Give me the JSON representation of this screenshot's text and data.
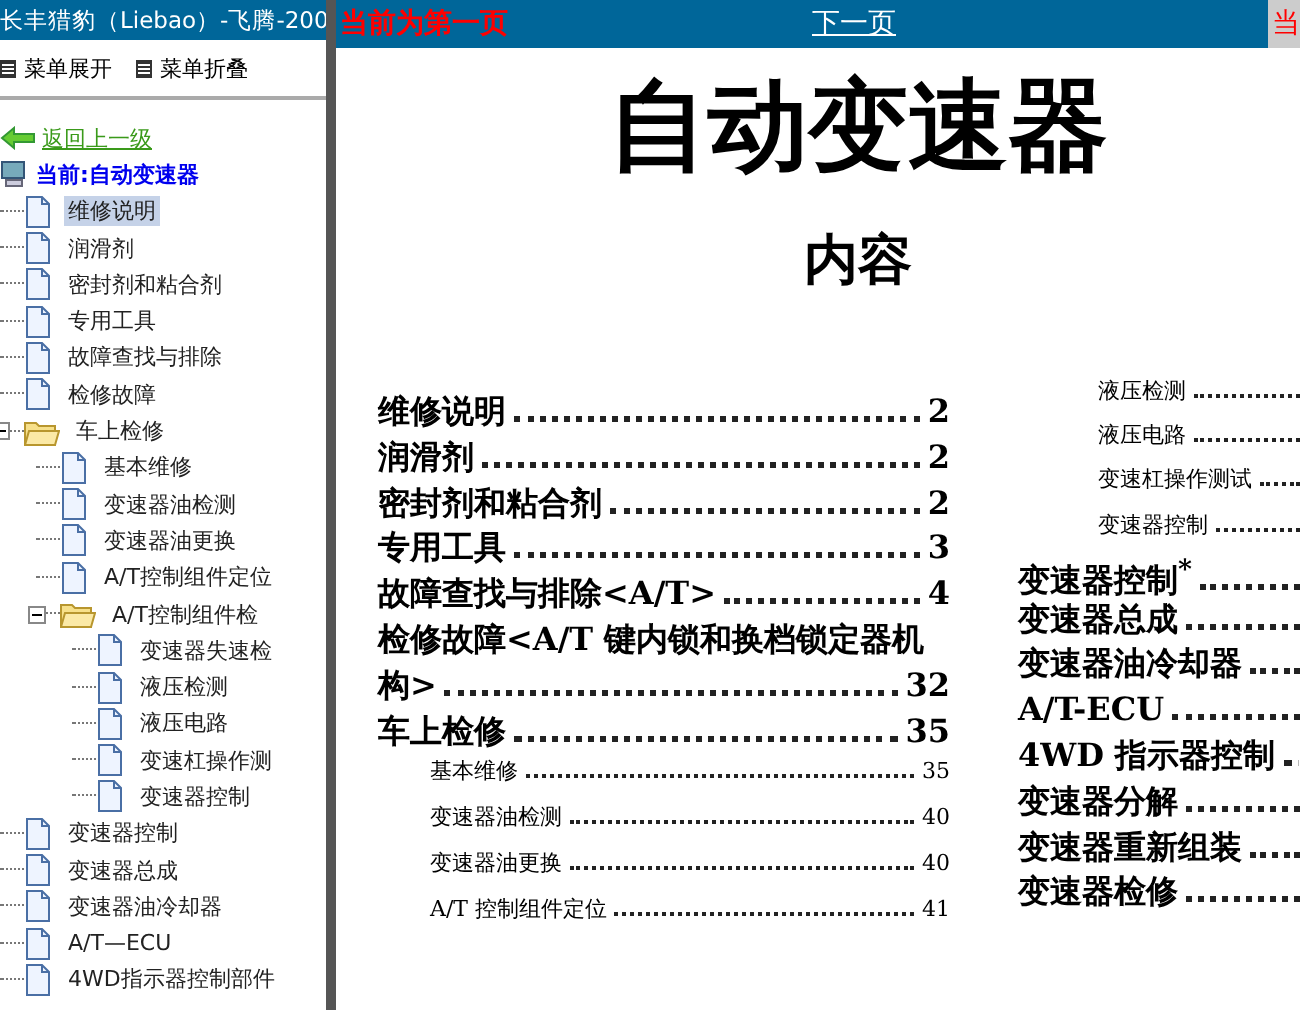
{
  "sidebar": {
    "title": "长丰猎豹（Liebao）-飞腾-200",
    "menu": [
      {
        "label": "菜单展开"
      },
      {
        "label": "菜单折叠"
      }
    ],
    "back_link": "返回上一级",
    "current": "当前:自动变速器",
    "tree": [
      {
        "label": "维修说明",
        "kind": "page",
        "selected": true
      },
      {
        "label": "润滑剂",
        "kind": "page",
        "selected": false
      },
      {
        "label": "密封剂和粘合剂",
        "kind": "page",
        "selected": false
      },
      {
        "label": "专用工具",
        "kind": "page",
        "selected": false
      },
      {
        "label": "故障查找与排除",
        "kind": "page",
        "selected": false
      },
      {
        "label": "检修故障",
        "kind": "page",
        "selected": false
      },
      {
        "label": "车上检修",
        "kind": "folder",
        "selected": false,
        "expanded": true,
        "children": [
          {
            "label": "基本维修",
            "kind": "page",
            "selected": false
          },
          {
            "label": "变速器油检测",
            "kind": "page",
            "selected": false
          },
          {
            "label": "变速器油更换",
            "kind": "page",
            "selected": false
          },
          {
            "label": "A/T控制组件定位",
            "kind": "page",
            "selected": false
          },
          {
            "label": "A/T控制组件检",
            "kind": "folder",
            "selected": false,
            "expanded": true,
            "children": [
              {
                "label": "变速器失速检",
                "kind": "page",
                "selected": false
              },
              {
                "label": "液压检测",
                "kind": "page",
                "selected": false
              },
              {
                "label": "液压电路",
                "kind": "page",
                "selected": false
              },
              {
                "label": "变速杠操作测",
                "kind": "page",
                "selected": false
              },
              {
                "label": "变速器控制",
                "kind": "page",
                "selected": false
              }
            ]
          }
        ]
      },
      {
        "label": "变速器控制",
        "kind": "page",
        "selected": false
      },
      {
        "label": "变速器总成",
        "kind": "page",
        "selected": false
      },
      {
        "label": "变速器油冷却器",
        "kind": "page",
        "selected": false
      },
      {
        "label": "A/T—ECU",
        "kind": "page",
        "selected": false
      },
      {
        "label": "4WD指示器控制部件",
        "kind": "page",
        "selected": false
      }
    ]
  },
  "top_bar": {
    "page_status": "当前为第一页",
    "next_link": "下一页",
    "status_cut": "当"
  },
  "document": {
    "title": "自动变速器",
    "heading": "内容",
    "columns": [
      [
        {
          "title": "维修说明",
          "page": "2",
          "kind": "main"
        },
        {
          "title": "润滑剂",
          "page": "2",
          "kind": "main"
        },
        {
          "title": "密封剂和粘合剂",
          "page": "2",
          "kind": "main"
        },
        {
          "title": "专用工具",
          "page": "3",
          "kind": "main"
        },
        {
          "title": "故障查找与排除<A/T>",
          "page": "4",
          "kind": "main"
        },
        {
          "title": "检修故障<A/T 键内锁和换档锁定器机",
          "kind": "line"
        },
        {
          "title": "构>",
          "page": "32",
          "kind": "main"
        },
        {
          "title": "车上检修",
          "page": "35",
          "kind": "main"
        },
        {
          "title": "基本维修",
          "page": "35",
          "kind": "sub"
        },
        {
          "title": "变速器油检测",
          "page": "40",
          "kind": "sub"
        },
        {
          "title": "变速器油更换",
          "page": "40",
          "kind": "sub"
        },
        {
          "title": "A/T 控制组件定位",
          "page": "41",
          "kind": "sub"
        }
      ],
      [
        {
          "title": "液压检测",
          "kind": "sub2"
        },
        {
          "title": "液压电路",
          "kind": "sub2"
        },
        {
          "title": "变速杠操作测试",
          "kind": "sub2"
        },
        {
          "title": "变速器控制",
          "kind": "sub2"
        },
        {
          "title": "变速器控制$^{*}$",
          "kind": "main"
        },
        {
          "title": "变速器总成",
          "kind": "main"
        },
        {
          "title": "变速器油冷却器",
          "kind": "main"
        },
        {
          "title": "A/T-ECU",
          "kind": "main"
        },
        {
          "title": "4WD 指示器控制",
          "kind": "main"
        },
        {
          "title": "变速器分解",
          "kind": "main"
        },
        {
          "title": "变速器重新组装",
          "kind": "main"
        },
        {
          "title": "变速器检修",
          "kind": "main"
        }
      ]
    ]
  }
}
